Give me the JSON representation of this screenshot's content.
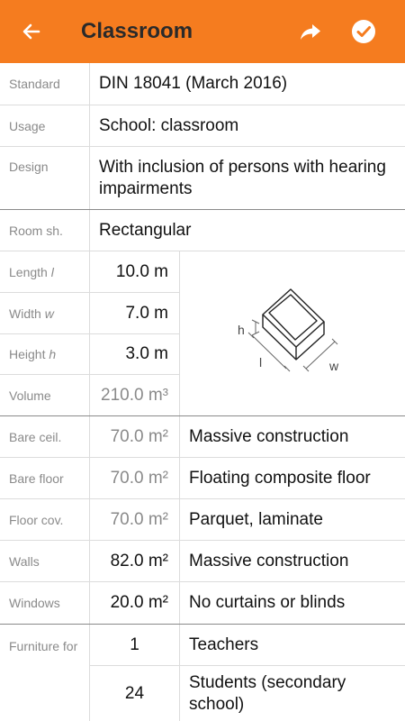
{
  "header": {
    "title": "Classroom",
    "back_icon": "arrow-left-icon",
    "share_icon": "share-arrow-icon",
    "confirm_icon": "check-circle-icon",
    "color": "#f57c1f"
  },
  "general": [
    {
      "label": "Standard",
      "value": "DIN 18041 (March 2016)"
    },
    {
      "label": "Usage",
      "value": "School: classroom"
    },
    {
      "label": "Design",
      "value": "With inclusion of persons with hearing impairments"
    }
  ],
  "room": {
    "shape_label": "Room sh.",
    "shape_value": "Rectangular",
    "dimensions": [
      {
        "label": "Length",
        "symbol": "l",
        "value": "10.0 m"
      },
      {
        "label": "Width",
        "symbol": "w",
        "value": "7.0 m"
      },
      {
        "label": "Height",
        "symbol": "h",
        "value": "3.0 m"
      }
    ],
    "volume_label": "Volume",
    "volume_value": "210.0 m³",
    "diagram": {
      "h": "h",
      "l": "l",
      "w": "w"
    }
  },
  "surfaces": [
    {
      "label": "Bare ceil.",
      "area": "70.0 m²",
      "material": "Massive construction",
      "computed": true
    },
    {
      "label": "Bare floor",
      "area": "70.0 m²",
      "material": "Floating composite floor",
      "computed": true
    },
    {
      "label": "Floor cov.",
      "area": "70.0 m²",
      "material": "Parquet, laminate",
      "computed": true
    },
    {
      "label": "Walls",
      "area": "82.0 m²",
      "material": "Massive construction",
      "computed": false
    },
    {
      "label": "Windows",
      "area": "20.0 m²",
      "material": "No curtains or blinds",
      "computed": false
    }
  ],
  "furniture": {
    "label": "Furniture for",
    "items": [
      {
        "count": "1",
        "type": "Teachers"
      },
      {
        "count": "24",
        "type": "Students (secondary school)"
      }
    ]
  }
}
